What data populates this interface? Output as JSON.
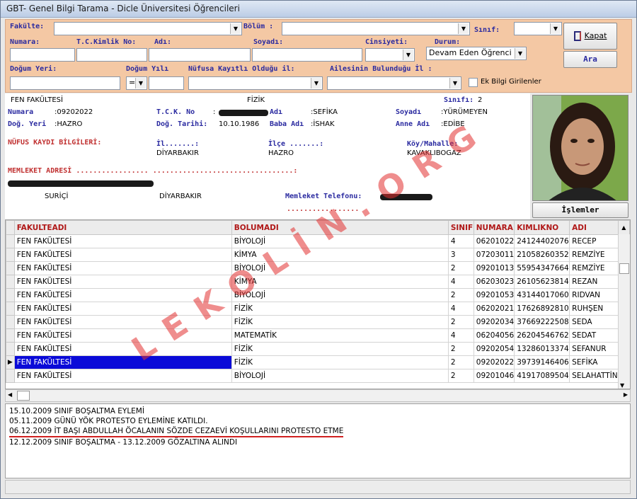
{
  "window": {
    "title": "GBT- Genel Bilgi Tarama - Dicle Üniversitesi Öğrencileri"
  },
  "filters": {
    "fakulte_label": "Fakülte:",
    "bolum_label": "Bölüm :",
    "sinif_label": "Sınıf:",
    "numara_label": "Numara:",
    "tc_label": "T.C.Kimlik No:",
    "adi_label": "Adı:",
    "soyadi_label": "Soyadı:",
    "cinsiyet_label": "Cinsiyeti:",
    "durum_label": "Durum:",
    "durum_value": "Devam Eden Öğrenci",
    "dogum_yeri_label": "Doğum Yeri:",
    "dogum_yili_label": "Doğum Yılı",
    "dogum_yili_op": "=",
    "nufus_il_label": "Nüfusa Kayıtlı Olduğu il:",
    "aile_il_label": "Ailesinin Bulunduğu İl :",
    "ek_bilgi_label": "Ek Bilgi Girilenler"
  },
  "buttons": {
    "kapat": "Kapat",
    "ara": "Ara",
    "islemler": "İşlemler"
  },
  "student": {
    "fakulte": "FEN FAKÜLTESİ",
    "bolum": "FİZİK",
    "sinif_label": "Sınıfı:",
    "sinif": "2",
    "numara_label": "Numara",
    "numara": ":09202022",
    "tck_label": "T.C.K. No",
    "tck_sep": ":",
    "adi_label": "Adı",
    "adi": ":SEFİKA",
    "soyadi_label": "Soyadı",
    "soyadi": ":YÜRÜMEYEN",
    "dog_yeri_label": "Doğ. Yeri",
    "dog_yeri": ":HAZRO",
    "dog_tarihi_label": "Doğ. Tarihi:",
    "dog_tarihi": "10.10.1986",
    "baba_label": "Baba Adı",
    "baba": ":İSHAK",
    "anne_label": "Anne Adı",
    "anne": ":EDİBE",
    "nufus_label": "NÜFUS KAYDI BİLGİLERİ:",
    "il_label": "İl.......:",
    "il": "DİYARBAKIR",
    "ilce_label": "İlçe .......:",
    "ilce": "HAZRO",
    "koy_label": "Köy/Mahalle:",
    "koy": "KAVAKLIBOGAZ",
    "adres_label": "MEMLEKET ADRESİ ................. .................................:",
    "adres_ilce": "SURİÇİ",
    "adres_il": "DİYARBAKIR",
    "telefon_label": "Memleket Telefonu:",
    "telefon_dots": "................."
  },
  "grid": {
    "columns": [
      "FAKULTEADI",
      "BOLUMADI",
      "SINIF",
      "NUMARA",
      "KIMLIKNO",
      "ADI"
    ],
    "rows": [
      [
        "FEN FAKÜLTESİ",
        "BİYOLOJİ",
        "4",
        "06201022",
        "24124402076",
        "RECEP"
      ],
      [
        "FEN FAKÜLTESİ",
        "KİMYA",
        "3",
        "07203011",
        "21058260352",
        "REMZİYE"
      ],
      [
        "FEN FAKÜLTESİ",
        "BİYOLOJİ",
        "2",
        "09201013",
        "55954347664",
        "REMZİYE"
      ],
      [
        "FEN FAKÜLTESİ",
        "KİMYA",
        "4",
        "06203023",
        "26105623814",
        "REZAN"
      ],
      [
        "FEN FAKÜLTESİ",
        "BİYOLOJİ",
        "2",
        "09201053",
        "43144017060",
        "RIDVAN"
      ],
      [
        "FEN FAKÜLTESİ",
        "FİZİK",
        "4",
        "06202021",
        "17626892810",
        "RUHŞEN"
      ],
      [
        "FEN FAKÜLTESİ",
        "FİZİK",
        "2",
        "09202034",
        "37669222508",
        "SEDA"
      ],
      [
        "FEN FAKÜLTESİ",
        "MATEMATİK",
        "4",
        "06204056",
        "26204546762",
        "SEDAT"
      ],
      [
        "FEN FAKÜLTESİ",
        "FİZİK",
        "2",
        "09202054",
        "13286013374",
        "SEFANUR"
      ],
      [
        "FEN FAKÜLTESİ",
        "FİZİK",
        "2",
        "09202022",
        "39739146406",
        "SEFİKA"
      ],
      [
        "FEN FAKÜLTESİ",
        "BİYOLOJİ",
        "2",
        "09201046",
        "41917089504",
        "SELAHATTİN"
      ]
    ],
    "selected_row": 9,
    "current_marker": "▶"
  },
  "notes": [
    "15.10.2009 SINIF BOŞALTMA EYLEMİ",
    "05.11.2009 GÜNÜ YÖK PROTESTO EYLEMİNE KATILDI.",
    "06.12.2009 İT BAŞI ABDULLAH ÖCALANIN SÖZDE CEZAEVİ KOŞULLARINI PROTESTO ETME",
    "12.12.2009 SINIF BOŞALTMA  -  13.12.2009  GÖZALTINA ALINDI"
  ],
  "watermark": "LEKOLİN.ORG",
  "colors": {
    "filter_bg": "#f4c8a4",
    "label_blue": "#2a2aa0",
    "header_red": "#b01818",
    "selection": "#0a0ad8",
    "underline_red": "#d02020"
  }
}
